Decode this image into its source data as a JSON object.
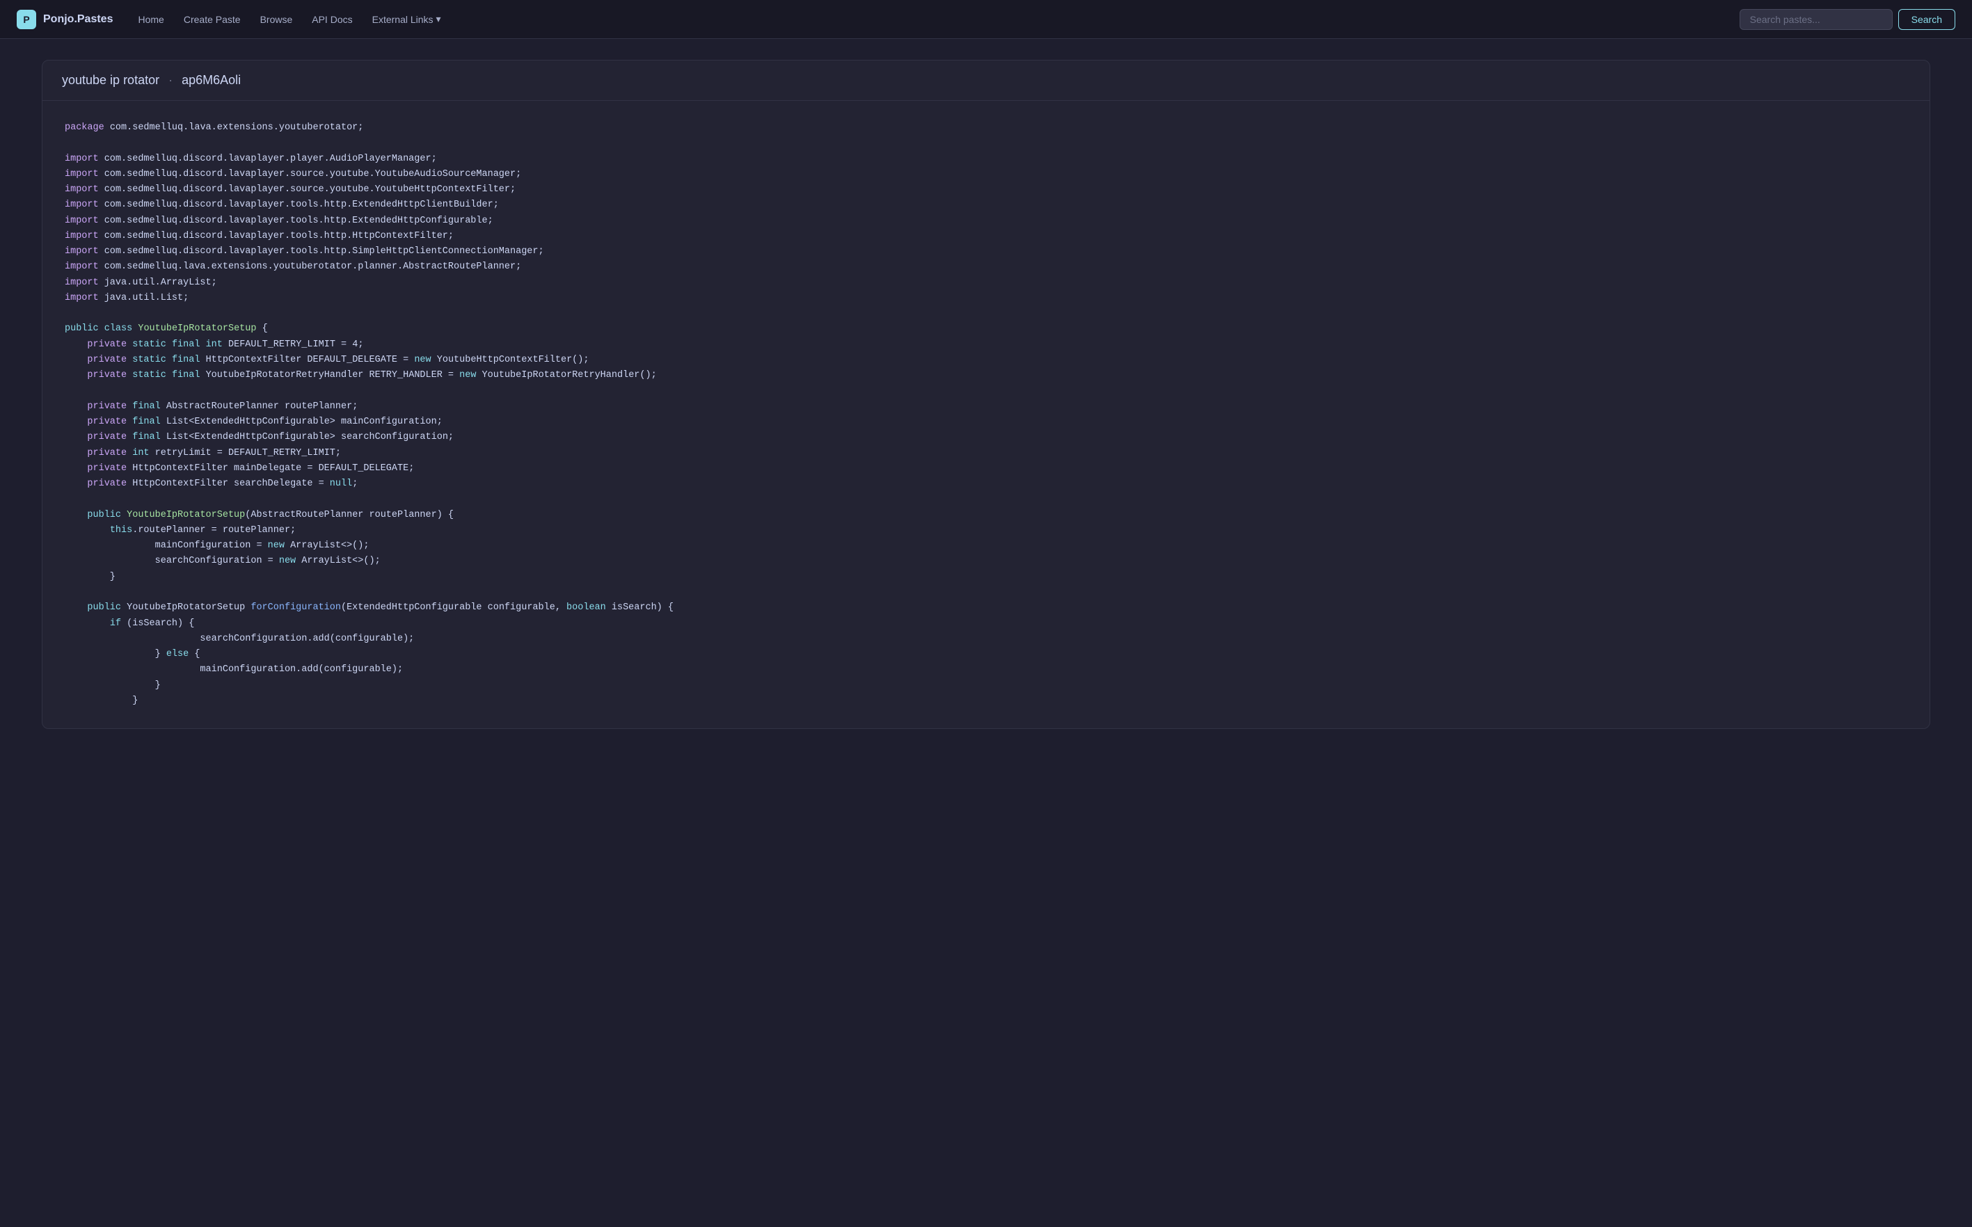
{
  "nav": {
    "brand_name": "Ponjo.Pastes",
    "links": [
      {
        "label": "Home",
        "id": "home"
      },
      {
        "label": "Create Paste",
        "id": "create-paste"
      },
      {
        "label": "Browse",
        "id": "browse"
      },
      {
        "label": "API Docs",
        "id": "api-docs"
      },
      {
        "label": "External Links",
        "id": "external-links",
        "has_dropdown": true
      }
    ],
    "search_placeholder": "Search pastes...",
    "search_btn_label": "Search"
  },
  "paste": {
    "title": "youtube ip rotator",
    "separator": "·",
    "id": "ap6M6Aoli"
  }
}
